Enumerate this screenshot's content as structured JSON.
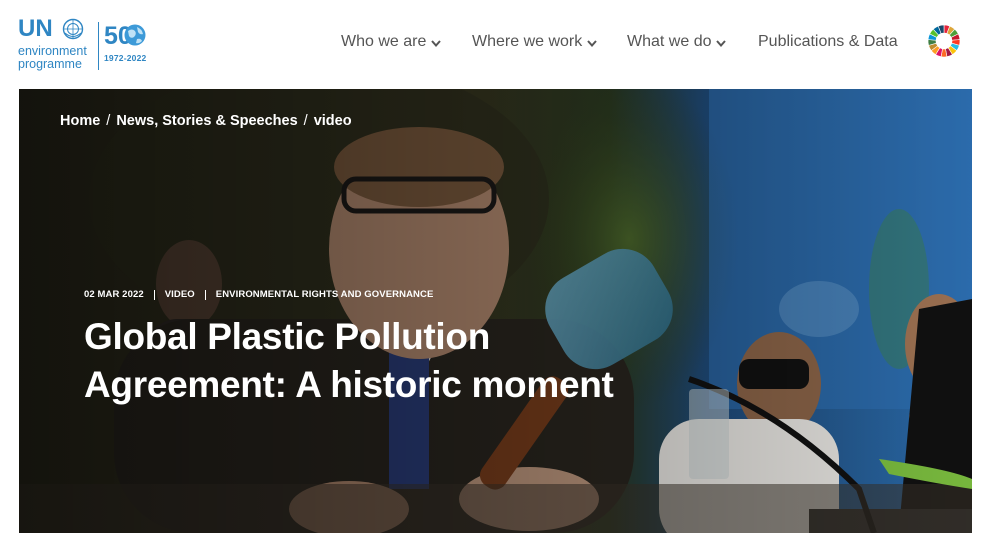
{
  "logo": {
    "brand": "UN",
    "line1": "environment",
    "line2": "programme",
    "anniversary": "50",
    "years": "1972-2022"
  },
  "nav": {
    "items": [
      {
        "label": "Who we are",
        "has_dropdown": true
      },
      {
        "label": "Where we work",
        "has_dropdown": true
      },
      {
        "label": "What we do",
        "has_dropdown": true
      },
      {
        "label": "Publications & Data",
        "has_dropdown": false
      }
    ],
    "sdg_icon": "sdg-wheel-icon"
  },
  "hero": {
    "breadcrumb": [
      {
        "label": "Home"
      },
      {
        "label": "News, Stories & Speeches"
      },
      {
        "label": "video"
      }
    ],
    "breadcrumb_separator": "/",
    "meta": {
      "date": "02 MAR 2022",
      "type": "VIDEO",
      "topic": "ENVIRONMENTAL RIGHTS AND GOVERNANCE"
    },
    "title_line1": "Global Plastic Pollution",
    "title_line2": "Agreement: A historic moment"
  },
  "colors": {
    "brand_blue": "#2f86c3",
    "nav_text": "#555555",
    "hero_text": "#ffffff"
  }
}
